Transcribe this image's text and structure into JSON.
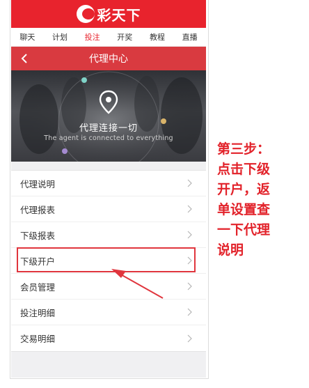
{
  "app": {
    "brand": "彩天下",
    "accent": "#e8232d",
    "title_bar_color": "#d93a40"
  },
  "nav": [
    {
      "label": "聊天",
      "active": false
    },
    {
      "label": "计划",
      "active": false
    },
    {
      "label": "投注",
      "active": true
    },
    {
      "label": "开奖",
      "active": false
    },
    {
      "label": "教程",
      "active": false
    },
    {
      "label": "直播",
      "active": false
    }
  ],
  "header": {
    "title": "代理中心",
    "back_icon": "chevron-left-icon"
  },
  "banner": {
    "title": "代理连接一切",
    "subtitle": "The agent is connected to everything",
    "icon": "location-pin-icon"
  },
  "menu": [
    {
      "label": "代理说明"
    },
    {
      "label": "代理报表"
    },
    {
      "label": "下级报表"
    },
    {
      "label": "下级开户",
      "highlighted": true
    },
    {
      "label": "会员管理"
    },
    {
      "label": "投注明细"
    },
    {
      "label": "交易明细"
    }
  ],
  "annotation": {
    "lines": [
      "第三步：",
      "点击下级",
      "开户，返",
      "单设置查",
      "一下代理",
      "说明"
    ],
    "color": "#e2222a"
  }
}
